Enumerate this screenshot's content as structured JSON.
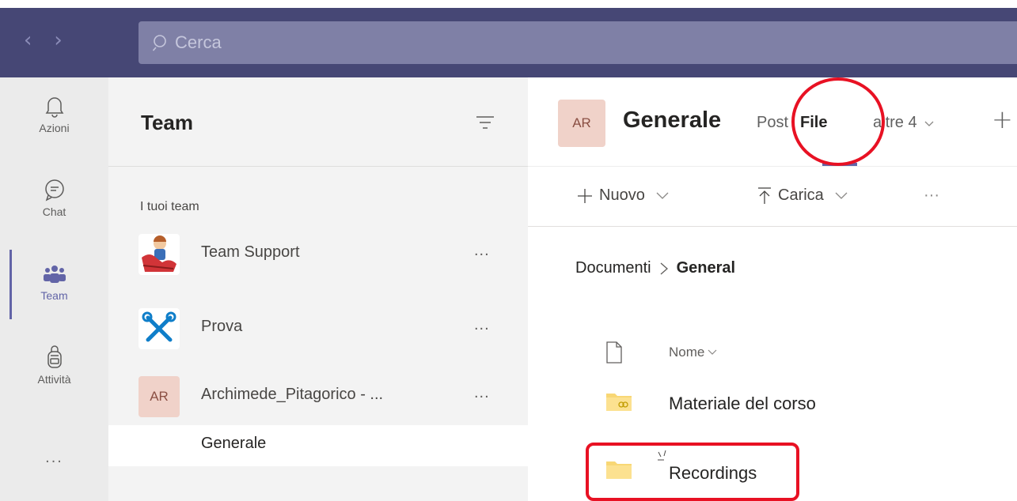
{
  "topbar": {
    "back_glyph": "‹",
    "forward_glyph": "›",
    "search_placeholder": "Cerca",
    "search_icon": "search-icon"
  },
  "rail": {
    "items": [
      {
        "label": "Azioni",
        "icon": "bell-icon"
      },
      {
        "label": "Chat",
        "icon": "chat-icon"
      },
      {
        "label": "Team",
        "icon": "teams-icon",
        "active": true
      },
      {
        "label": "Attività",
        "icon": "backpack-icon"
      }
    ],
    "more": "..."
  },
  "teams_panel": {
    "title": "Team",
    "filter_icon": "filter-icon",
    "section_label": "I tuoi team",
    "teams": [
      {
        "name": "Team Support",
        "avatar": "team-support-avatar",
        "more": "..."
      },
      {
        "name": "Prova",
        "avatar": "tools-avatar",
        "more": "..."
      },
      {
        "name": "Archimede_Pitagorico - ...",
        "avatar_text": "AR",
        "more": "..."
      }
    ],
    "channel": "Generale"
  },
  "main": {
    "avatar_text": "AR",
    "channel_title": "Generale",
    "tabs": {
      "post": "Post",
      "file": "File",
      "more": "altre 4",
      "add": "+"
    },
    "toolbar": {
      "new_label": "Nuovo",
      "upload_label": "Carica",
      "more": "···"
    },
    "breadcrumb": {
      "root": "Documenti",
      "separator": ">",
      "current": "General"
    },
    "columns": {
      "name": "Nome"
    },
    "files": [
      {
        "name": "Materiale del corso",
        "icon": "shared-folder-icon"
      },
      {
        "name": "Recordings",
        "icon": "folder-icon"
      }
    ]
  },
  "colors": {
    "title_bar": "#464775",
    "search_bg": "#7f80a6",
    "accent": "#6264a7",
    "rail_bg": "#ebebeb",
    "panel_bg": "#f3f3f3",
    "annotation": "#e81123",
    "folder": "#f8d775"
  }
}
